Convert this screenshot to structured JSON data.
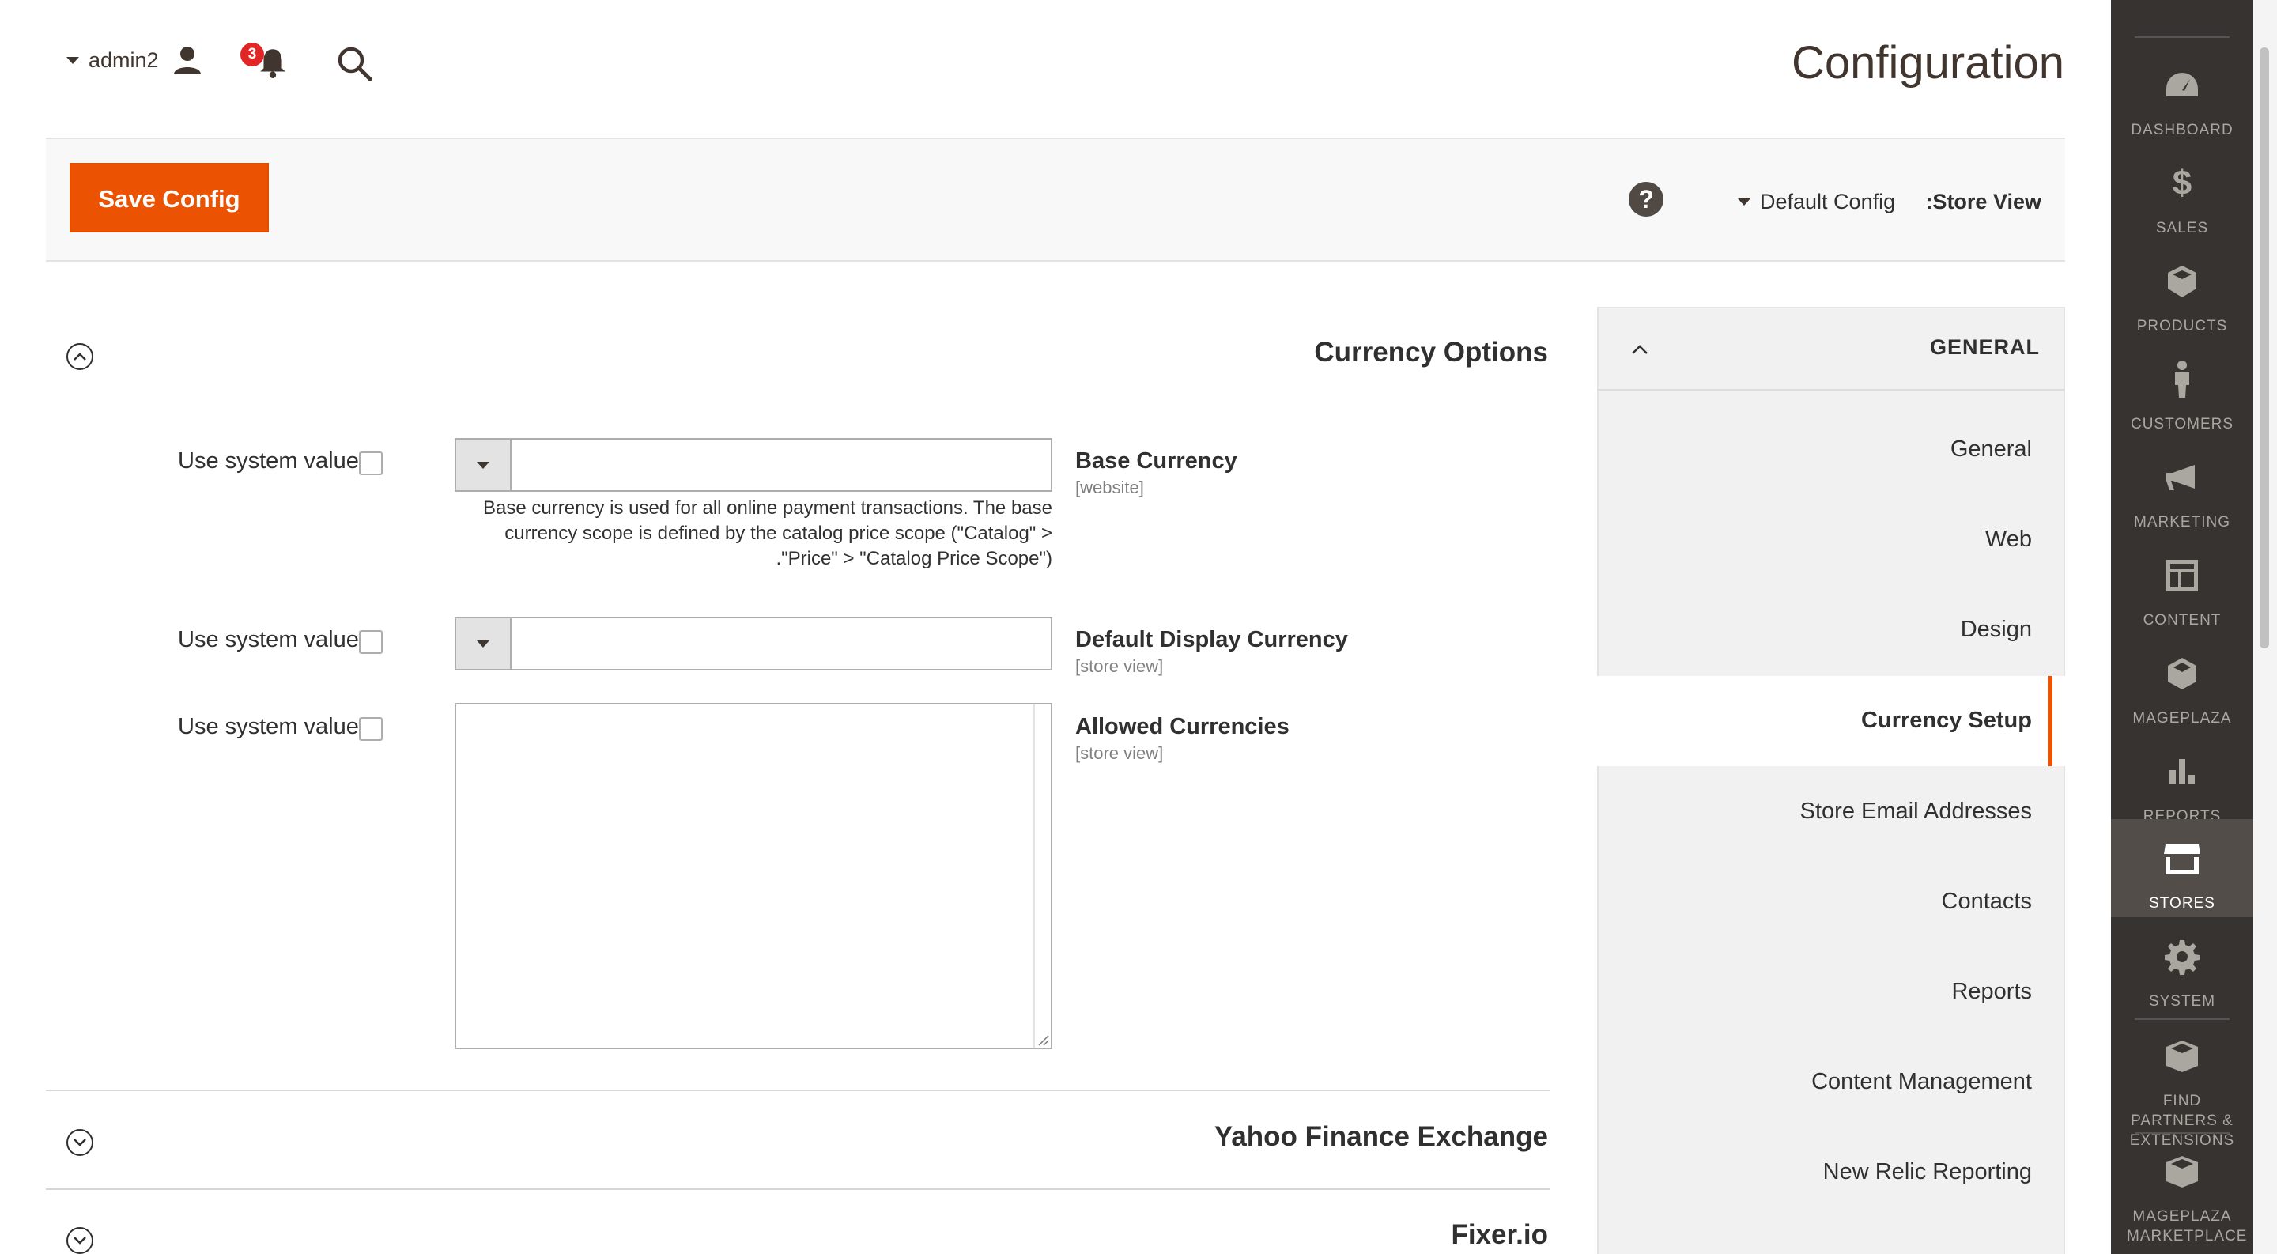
{
  "header": {
    "page_title": "Configuration",
    "username": "admin2",
    "notification_count": "3"
  },
  "actions": {
    "save_label": "Save Config",
    "help_glyph": "?",
    "scope_value": "Default Config",
    "scope_label": ":Store View"
  },
  "section": {
    "currency_options": {
      "title": "Currency Options",
      "fields": [
        {
          "label": "Base Currency",
          "scope": "[website]",
          "use_system": "Use system value",
          "value": "",
          "note": "Base currency is used for all online payment transactions. The base currency scope is defined by the catalog price scope (\"Catalog\" > \"Price\" > \"Catalog Price Scope\")."
        },
        {
          "label": "Default Display Currency",
          "scope": "[store view]",
          "use_system": "Use system value",
          "value": ""
        },
        {
          "label": "Allowed Currencies",
          "scope": "[store view]",
          "use_system": "Use system value"
        }
      ]
    },
    "yahoo": {
      "title": "Yahoo Finance Exchange"
    },
    "fixer": {
      "title": "Fixer.io"
    }
  },
  "config_tabs": {
    "group_title": "GENERAL",
    "items": [
      {
        "label": "General"
      },
      {
        "label": "Web"
      },
      {
        "label": "Design"
      },
      {
        "label": "Currency Setup",
        "active": true
      },
      {
        "label": "Store Email Addresses"
      },
      {
        "label": "Contacts"
      },
      {
        "label": "Reports"
      },
      {
        "label": "Content Management"
      },
      {
        "label": "New Relic Reporting"
      }
    ]
  },
  "admin_nav": {
    "items": [
      {
        "label": "DASHBOARD",
        "icon": "dashboard-icon"
      },
      {
        "label": "SALES",
        "icon": "dollar-icon"
      },
      {
        "label": "PRODUCTS",
        "icon": "cube-icon"
      },
      {
        "label": "CUSTOMERS",
        "icon": "person-icon"
      },
      {
        "label": "MARKETING",
        "icon": "megaphone-icon"
      },
      {
        "label": "CONTENT",
        "icon": "layout-icon"
      },
      {
        "label": "MAGEPLAZA",
        "icon": "mageplaza-icon"
      },
      {
        "label": "REPORTS",
        "icon": "bar-chart-icon"
      },
      {
        "label": "STORES",
        "icon": "store-icon",
        "active": true
      },
      {
        "label": "SYSTEM",
        "icon": "gear-icon"
      },
      {
        "label": "FIND PARTNERS & EXTENSIONS",
        "icon": "blocks-icon"
      },
      {
        "label": "MAGEPLAZA MARKETPLACE",
        "icon": "blocks-icon"
      }
    ]
  }
}
